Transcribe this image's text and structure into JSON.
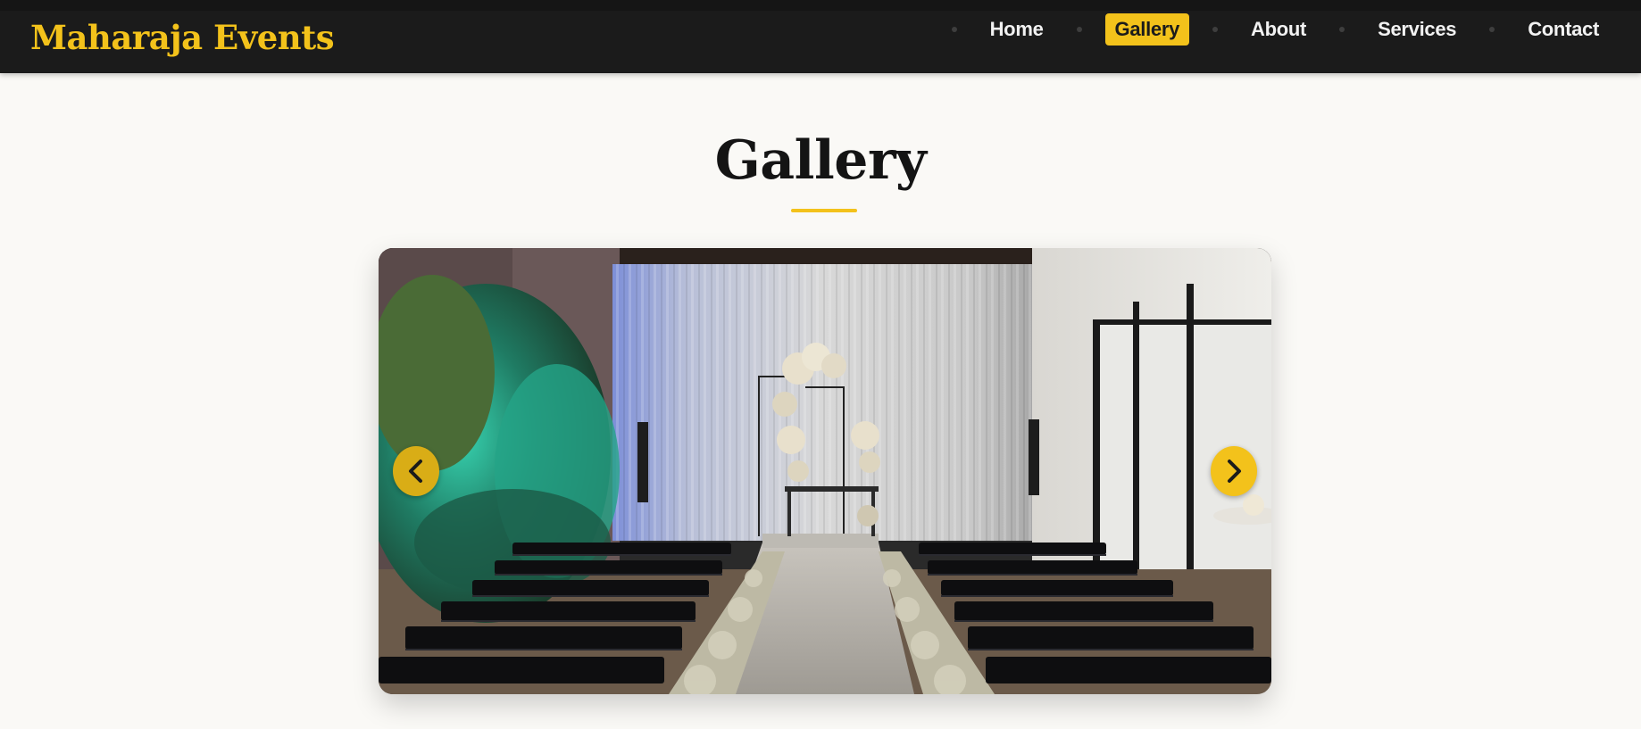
{
  "brand": {
    "name": "Maharaja Events"
  },
  "nav": {
    "items": [
      {
        "label": "Home",
        "active": false
      },
      {
        "label": "Gallery",
        "active": true
      },
      {
        "label": "About",
        "active": false
      },
      {
        "label": "Services",
        "active": false
      },
      {
        "label": "Contact",
        "active": false
      }
    ]
  },
  "gallery": {
    "title": "Gallery",
    "carousel": {
      "prev_icon": "chevron-left-icon",
      "next_icon": "chevron-right-icon"
    }
  },
  "colors": {
    "accent": "#f3c21b",
    "header_bg": "#1b1b1b",
    "page_bg": "#faf9f6",
    "title_text": "#141414"
  }
}
